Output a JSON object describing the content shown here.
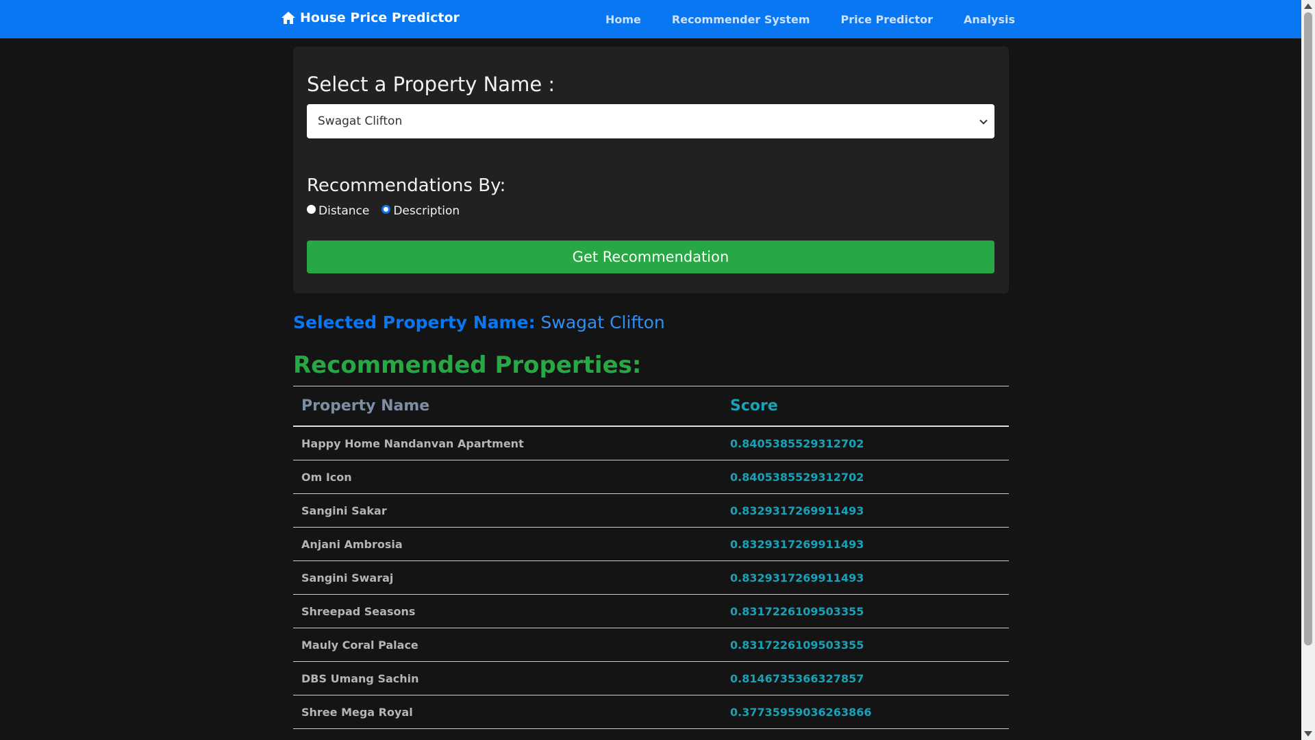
{
  "navbar": {
    "brand": "House Price Predictor",
    "links": [
      "Home",
      "Recommender System",
      "Price Predictor",
      "Analysis"
    ]
  },
  "form": {
    "title": "Select a Property Name :",
    "selected_property": "Swagat Clifton",
    "recommendations_by_label": "Recommendations By:",
    "options": [
      {
        "label": "Distance",
        "checked": false
      },
      {
        "label": "Description",
        "checked": true
      }
    ],
    "button_label": "Get Recommendation"
  },
  "selected": {
    "label": "Selected Property Name:",
    "value": "Swagat Clifton"
  },
  "results": {
    "heading": "Recommended Properties:",
    "columns": [
      "Property Name",
      "Score"
    ],
    "rows": [
      {
        "name": "Happy Home Nandanvan Apartment",
        "score": "0.8405385529312702"
      },
      {
        "name": "Om Icon",
        "score": "0.8405385529312702"
      },
      {
        "name": "Sangini Sakar",
        "score": "0.8329317269911493"
      },
      {
        "name": "Anjani Ambrosia",
        "score": "0.8329317269911493"
      },
      {
        "name": "Sangini Swaraj",
        "score": "0.8329317269911493"
      },
      {
        "name": "Shreepad Seasons",
        "score": "0.8317226109503355"
      },
      {
        "name": "Mauly Coral Palace",
        "score": "0.8317226109503355"
      },
      {
        "name": "DBS Umang Sachin",
        "score": "0.8146735366327857"
      },
      {
        "name": "Shree Mega Royal",
        "score": "0.37735959036263866"
      }
    ]
  },
  "colors": {
    "navbar": "#0a77f2",
    "background": "#141414",
    "card": "#212121",
    "button": "#28a745",
    "score": "#17a2b8"
  }
}
